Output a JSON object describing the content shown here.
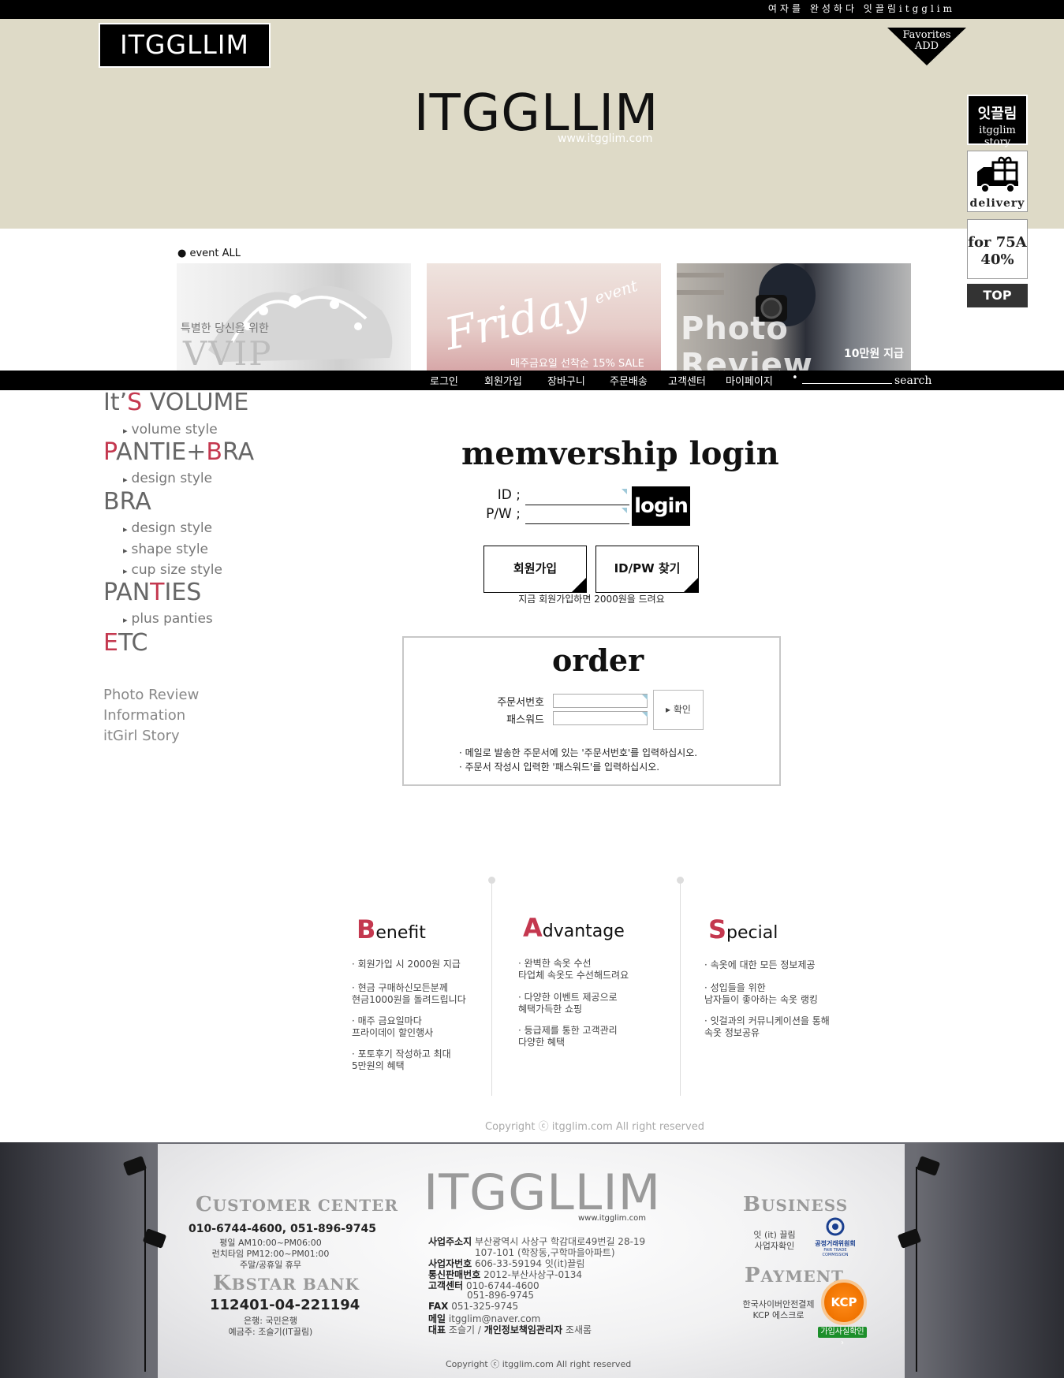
{
  "top": {
    "tagline": "여자를 완성하다 잇끌림itgglim"
  },
  "header": {
    "logo": "ITGGLLIM",
    "favorites_line1": "Favorites",
    "favorites_line2": "ADD",
    "brand": "ITGGLLIM",
    "brand_url": "www.itgglim.com"
  },
  "quick_menu": {
    "story_title": "잇끌림",
    "story_sub": "itgglim story",
    "delivery": "delivery",
    "size_line1": "for 75A",
    "size_line2": "40%",
    "top": "TOP"
  },
  "events": {
    "label": "● event ALL",
    "vvip_small": "특별한 당신을 위한",
    "vvip_big": "VVIP",
    "friday_big": "Friday",
    "friday_event": "event",
    "friday_sale": "매주금요일 선착순 15% SALE",
    "photo_big": "Photo Review",
    "photo_sub": "10만원 지급"
  },
  "nav": {
    "items": [
      "로그인",
      "회원가입",
      "장바구니",
      "주문배송",
      "고객센터",
      "마이페이지"
    ],
    "search_dot": "•",
    "search_label": "search"
  },
  "categories": {
    "volume_pre": "It’",
    "volume_hi": "S",
    "volume_post": " VOLUME",
    "volume_sub": "volume style",
    "pb_hi1": "P",
    "pb_mid": "ANTIE+",
    "pb_hi2": "B",
    "pb_post": "RA",
    "pb_sub": "design style",
    "bra": "BRA",
    "bra_subs": [
      "design style",
      "shape style",
      "cup size style"
    ],
    "panties_pre": "PAN",
    "panties_hi": "T",
    "panties_post": "IES",
    "panties_sub": "plus panties",
    "etc_hi": "E",
    "etc_post": "TC",
    "links": [
      "Photo Review",
      "Information",
      "itGirl Story"
    ]
  },
  "login": {
    "title": "memvership login",
    "id_label": "ID ;",
    "pw_label": "P/W ;",
    "button": "login",
    "join_button": "회원가입",
    "find_button": "ID/PW 찾기",
    "join_note": "지금 회원가입하면 2000원을 드려요"
  },
  "order": {
    "title": "order",
    "no_label": "주문서번호",
    "pw_label": "패스워드",
    "button": "▸ 확인",
    "notes": [
      "· 메일로 발송한 주문서에 있는 '주문서번호'를 입력하십시오.",
      "· 주문서 작성시 입력한 '패스워드'를 입력하십시오."
    ]
  },
  "benefits": [
    {
      "cap": "B",
      "rest": "enefit",
      "items": [
        "회원가입 시 2000원 지급",
        "현금 구매하신모든분께\n현금1000원을 돌려드립니다",
        "매주 금요일마다\n프라이데이 할인행사",
        "포토후기 작성하고 최대\n5만원의 혜택"
      ]
    },
    {
      "cap": "A",
      "rest": "dvantage",
      "items": [
        "완벽한 속옷 수선\n타업체 속옷도 수선해드려요",
        "다양한 이벤트 제공으로\n혜택가득한 쇼핑",
        "등급제를 통한 고객관리\n다양한 혜택"
      ]
    },
    {
      "cap": "S",
      "rest": "pecial",
      "items": [
        "속옷에 대한 모든 정보제공",
        "성입들을 위한\n남자들이 좋아하는 속옷 랭킹",
        "잇걸과의 커뮤니케이션을 통해\n속옷 정보공유"
      ]
    }
  ],
  "copyright": "Copyright ⓒ itgglim.com All right reserved",
  "footer": {
    "cc_cap": "C",
    "cc_rest": "USTOMER CENTER",
    "cc_phone": "010-6744-4600, 051-896-9745",
    "cc_hours": [
      "평일 AM10:00~PM06:00",
      "런치타임 PM12:00~PM01:00",
      "주말/공휴일 휴무"
    ],
    "bank_cap": "K",
    "bank_rest": "BSTAR BANK",
    "bank_account": "112401-04-221194",
    "bank_info": [
      "은행: 국민은행",
      "예금주: 조슬기(IT끌림)"
    ],
    "brand": "ITGGLLIM",
    "brand_url": "www.itgglim.com",
    "info": [
      {
        "k": "사업주소지",
        "v": "부산광역시 사상구 학감대로49번길 28-19"
      },
      {
        "k": "",
        "v": "107-101 (학장동,구학마을아파트)"
      },
      {
        "k": "사업자번호",
        "v": "606-33-59194 잇(it)끌림"
      },
      {
        "k": "통신판매번호",
        "v": "2012-부산사상구-0134"
      },
      {
        "k": "고객센터",
        "v": "010-6744-4600"
      },
      {
        "k": "",
        "v": "051-896-9745"
      },
      {
        "k": "FAX",
        "v": "051-325-9745"
      },
      {
        "k": "메일",
        "v": "itgglim@naver.com"
      },
      {
        "k": "대표",
        "v": "조슬기 / "
      }
    ],
    "privacy_k": "개인정보책임관리자",
    "privacy_v": " 조새롬",
    "business_cap": "B",
    "business_rest": "USINESS",
    "business_lines": [
      "잇 (it) 끌림",
      "사업자확인"
    ],
    "ftc_label": "공정거래위원회",
    "ftc_en": "FAIR TRADE COMMISSION",
    "payment_cap": "P",
    "payment_rest": "AYMENT",
    "payment_lines": [
      "한국사이버안전결제",
      "KCP 에스크로"
    ],
    "kcp": "KCP",
    "kcp_label": "가입사실확인 ›",
    "copyright": "Copyright ⓒ itgglim.com All right reserved"
  }
}
